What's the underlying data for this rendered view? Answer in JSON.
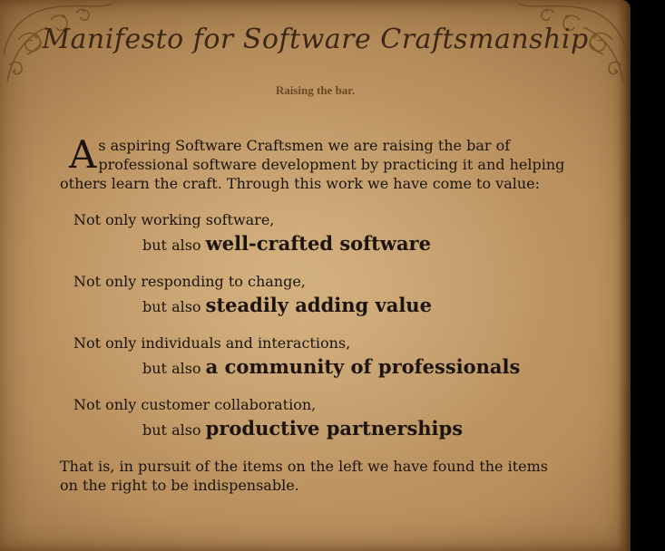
{
  "title": "Manifesto for Software Craftsmanship",
  "subtitle": "Raising the bar.",
  "intro": {
    "drop_cap": "A",
    "text": "s aspiring Software Craftsmen we are raising the bar of professional software development by practicing it and helping others learn the craft. Through this work we have come to value:"
  },
  "values": [
    {
      "left": "Not only working software,",
      "connector": "but also",
      "right": "well-crafted software"
    },
    {
      "left": "Not only responding to change,",
      "connector": "but also",
      "right": "steadily adding value"
    },
    {
      "left": "Not only individuals and interactions,",
      "connector": "but also",
      "right": "a community of professionals"
    },
    {
      "left": "Not only customer collaboration,",
      "connector": "but also",
      "right": "productive partnerships"
    }
  ],
  "conclusion": "That is, in pursuit of the items on the left we have found the items on the right to be indispensable.",
  "colors": {
    "background": "#000000",
    "parchment": "#c09a68",
    "ink": "#1c140c",
    "title_ink": "#3c2616",
    "subtitle_ink": "#6d4624"
  },
  "icons": [
    "corner-ornament-top-left-icon",
    "corner-ornament-top-right-icon"
  ]
}
